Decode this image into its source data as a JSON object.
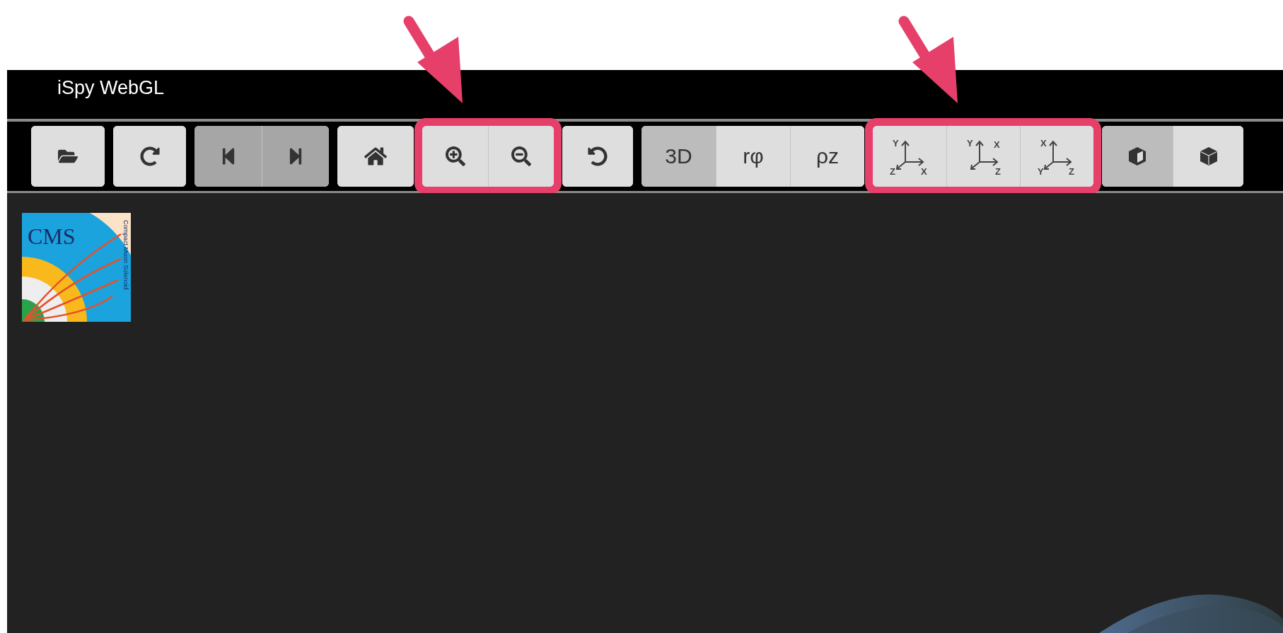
{
  "header": {
    "title": "iSpy WebGL"
  },
  "toolbar": {
    "groups": [
      {
        "highlighted": false,
        "buttons": [
          {
            "kind": "icon",
            "disabled": false
          }
        ]
      },
      {
        "highlighted": false,
        "buttons": [
          {
            "kind": "icon",
            "disabled": false
          }
        ]
      },
      {
        "highlighted": false,
        "buttons": [
          {
            "kind": "icon",
            "disabled": true
          },
          {
            "kind": "icon",
            "disabled": true
          }
        ]
      },
      {
        "highlighted": false,
        "buttons": [
          {
            "kind": "icon",
            "disabled": false
          }
        ]
      },
      {
        "highlighted": true,
        "buttons": [
          {
            "kind": "icon",
            "disabled": false
          },
          {
            "kind": "icon",
            "disabled": false
          }
        ]
      },
      {
        "highlighted": false,
        "buttons": [
          {
            "kind": "icon",
            "disabled": false
          }
        ]
      },
      {
        "highlighted": false,
        "buttons": [
          {
            "kind": "text",
            "label": "3D",
            "disabled": false,
            "selected": true
          },
          {
            "kind": "text",
            "label": "rφ",
            "disabled": false,
            "selected": false
          },
          {
            "kind": "text",
            "label": "ρz",
            "disabled": false,
            "selected": false
          }
        ]
      },
      {
        "highlighted": true,
        "buttons": [
          {
            "kind": "axes",
            "top_left": "Y",
            "bottom_left": "Z",
            "bottom_right": "X",
            "disabled": false
          },
          {
            "kind": "axes",
            "top_left": "Y",
            "top_right": "X",
            "bottom_right": "Z",
            "disabled": false
          },
          {
            "kind": "axes",
            "top_left": "X",
            "bottom_left": "Y",
            "bottom_right": "Z",
            "disabled": false
          }
        ]
      },
      {
        "highlighted": false,
        "buttons": [
          {
            "kind": "icon",
            "disabled": false,
            "selected": true
          },
          {
            "kind": "icon",
            "disabled": false,
            "selected": false
          }
        ]
      }
    ]
  },
  "logo": {
    "name": "CMS",
    "subtitle": "Compact Muon Solenoid"
  }
}
